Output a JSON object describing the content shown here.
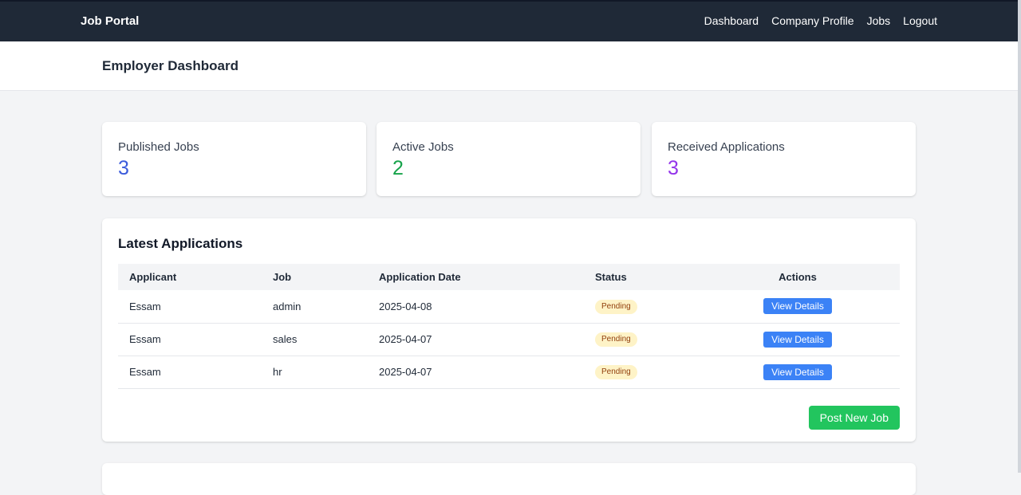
{
  "nav": {
    "brand": "Job Portal",
    "links": [
      "Dashboard",
      "Company Profile",
      "Jobs",
      "Logout"
    ]
  },
  "header": {
    "title": "Employer Dashboard"
  },
  "stats": [
    {
      "label": "Published Jobs",
      "value": "3",
      "color": "#3b5bdb"
    },
    {
      "label": "Active Jobs",
      "value": "2",
      "color": "#16a34a"
    },
    {
      "label": "Received Applications",
      "value": "3",
      "color": "#9333ea"
    }
  ],
  "applications": {
    "title": "Latest Applications",
    "columns": [
      "Applicant",
      "Job",
      "Application Date",
      "Status",
      "Actions"
    ],
    "rows": [
      {
        "applicant": "Essam",
        "job": "admin",
        "date": "2025-04-08",
        "status": "Pending",
        "action": "View Details"
      },
      {
        "applicant": "Essam",
        "job": "sales",
        "date": "2025-04-07",
        "status": "Pending",
        "action": "View Details"
      },
      {
        "applicant": "Essam",
        "job": "hr",
        "date": "2025-04-07",
        "status": "Pending",
        "action": "View Details"
      }
    ],
    "post_button": "Post New Job"
  },
  "colors": {
    "navbar": "#1f2937",
    "view_button": "#3b82f6",
    "post_button": "#22c55e",
    "pending_badge": "#fef3c7"
  }
}
